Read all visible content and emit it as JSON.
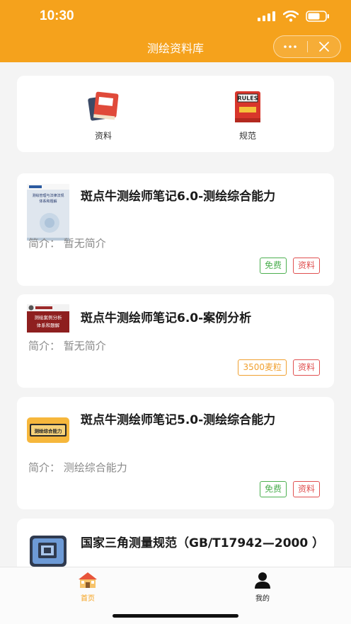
{
  "status_bar": {
    "time": "10:30"
  },
  "nav": {
    "title": "测绘资料库"
  },
  "categories": [
    {
      "label": "资料",
      "icon": "book-icon"
    },
    {
      "label": "规范",
      "icon": "rules-book-icon"
    }
  ],
  "cards": [
    {
      "title": "斑点牛测绘师笔记6.0-测绘综合能力",
      "intro": "简介：  暂无简介",
      "tags": [
        {
          "text": "免费",
          "kind": "free"
        },
        {
          "text": "资料",
          "kind": "type"
        }
      ],
      "thumb_lines": [
        "测绘管理与法律法规",
        "体系和题解"
      ]
    },
    {
      "title": "斑点牛测绘师笔记6.0-案例分析",
      "intro": "简介：  暂无简介",
      "tags": [
        {
          "text": "3500麦粒",
          "kind": "price"
        },
        {
          "text": "资料",
          "kind": "type"
        }
      ],
      "thumb_lines": [
        "测绘案例分析",
        "体系和题解"
      ]
    },
    {
      "title": "斑点牛测绘师笔记5.0-测绘综合能力",
      "intro": "简介：  测绘综合能力",
      "tags": [
        {
          "text": "免费",
          "kind": "free"
        },
        {
          "text": "资料",
          "kind": "type"
        }
      ],
      "thumb_lines": [
        "测绘综合能力"
      ]
    },
    {
      "title": "国家三角测量规范（GB/T17942—2000 ）",
      "intro": "",
      "tags": [],
      "thumb_lines": []
    }
  ],
  "tabbar": [
    {
      "label": "首页",
      "icon": "home-icon",
      "active": true
    },
    {
      "label": "我的",
      "icon": "user-icon",
      "active": false
    }
  ],
  "colors": {
    "brand": "#f5a21c",
    "free": "#4caf50",
    "type": "#e05050",
    "price": "#f0a030",
    "active_tab": "#f5a21c"
  }
}
